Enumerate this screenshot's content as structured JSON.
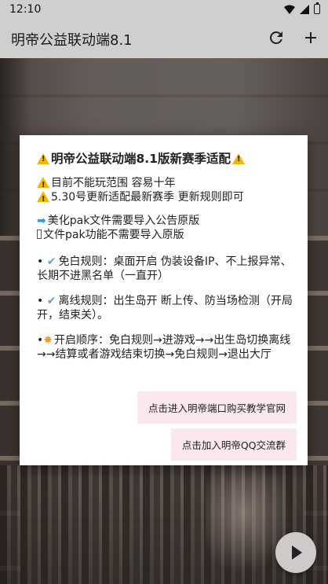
{
  "status_bar": {
    "time": "12:10"
  },
  "app_bar": {
    "title": "明帝公益联动端8.1"
  },
  "dialog": {
    "title": "明帝公益联动端8.1版新赛季适配",
    "line_warn1": "目前不能玩范围 容易十年",
    "line_warn2": "5.30号更新适配最新赛季 更新规则即可",
    "line_pak1": "美化pak文件需要导入公告原版",
    "line_pak2": "文件pak功能不需要导入原版",
    "rule_free": "免白规则：桌面开启 伪装设备IP、不上报异常、长期不进黑名单（一直开）",
    "rule_offline": "离线规则：出生岛开 断上传、防当场检测（开局开，结束关）。",
    "rule_order": "开启顺序：免白规则→进游戏→→出生岛切换离线→→结算或者游戏结束切换→免白规则→退出大厅",
    "button_buy": "点击进入明帝端口购买教学官网",
    "button_qq": "点击加入明帝QQ交流群"
  }
}
